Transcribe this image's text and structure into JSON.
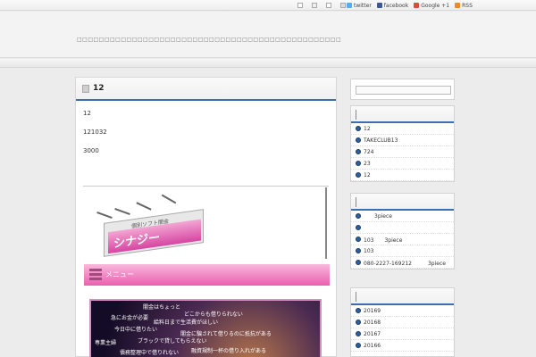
{
  "topbar": {
    "social": [
      {
        "label": "twitter",
        "icon": "twitter-icon"
      },
      {
        "label": "facebook",
        "icon": "facebook-icon"
      },
      {
        "label": "Google +1",
        "icon": "google-plus-icon"
      },
      {
        "label": "RSS",
        "icon": "rss-icon"
      }
    ]
  },
  "header": {
    "description": "□□□□□□□□□□□□□□□□□□□□□□□□□□□□□□□□□□□□□□□□□□□□□□□□"
  },
  "post": {
    "title": "12",
    "lines": [
      "12",
      "121032",
      "3000"
    ]
  },
  "ad": {
    "billboard_small": "個別ソフト闇金",
    "billboard_big": "シナジー",
    "menu_label": "メニュー",
    "poster_lines": [
      "闇金はちょっと",
      "どこからも借りられない",
      "急にお金が必要",
      "給料日まで生活費がほしい",
      "今日中に借りたい",
      "闇金に騙されて借りるのに抵抗がある",
      "ブラックで貸してもらえない",
      "専業主婦",
      "債務整理中で借りれない",
      "融資規制一杯の借り入れがある"
    ]
  },
  "sidebar": {
    "box1": [
      "12",
      "TAKECLUB13",
      "724",
      "23",
      "12"
    ],
    "box2": [
      "3piece",
      "",
      "103　　3piece",
      "103",
      "080-2227-169212　　　3piece"
    ],
    "box3": [
      "20169",
      "20168",
      "20167",
      "20166"
    ]
  },
  "colors": {
    "accent": "#3b6fb2",
    "pink": "#ea5fb0"
  }
}
